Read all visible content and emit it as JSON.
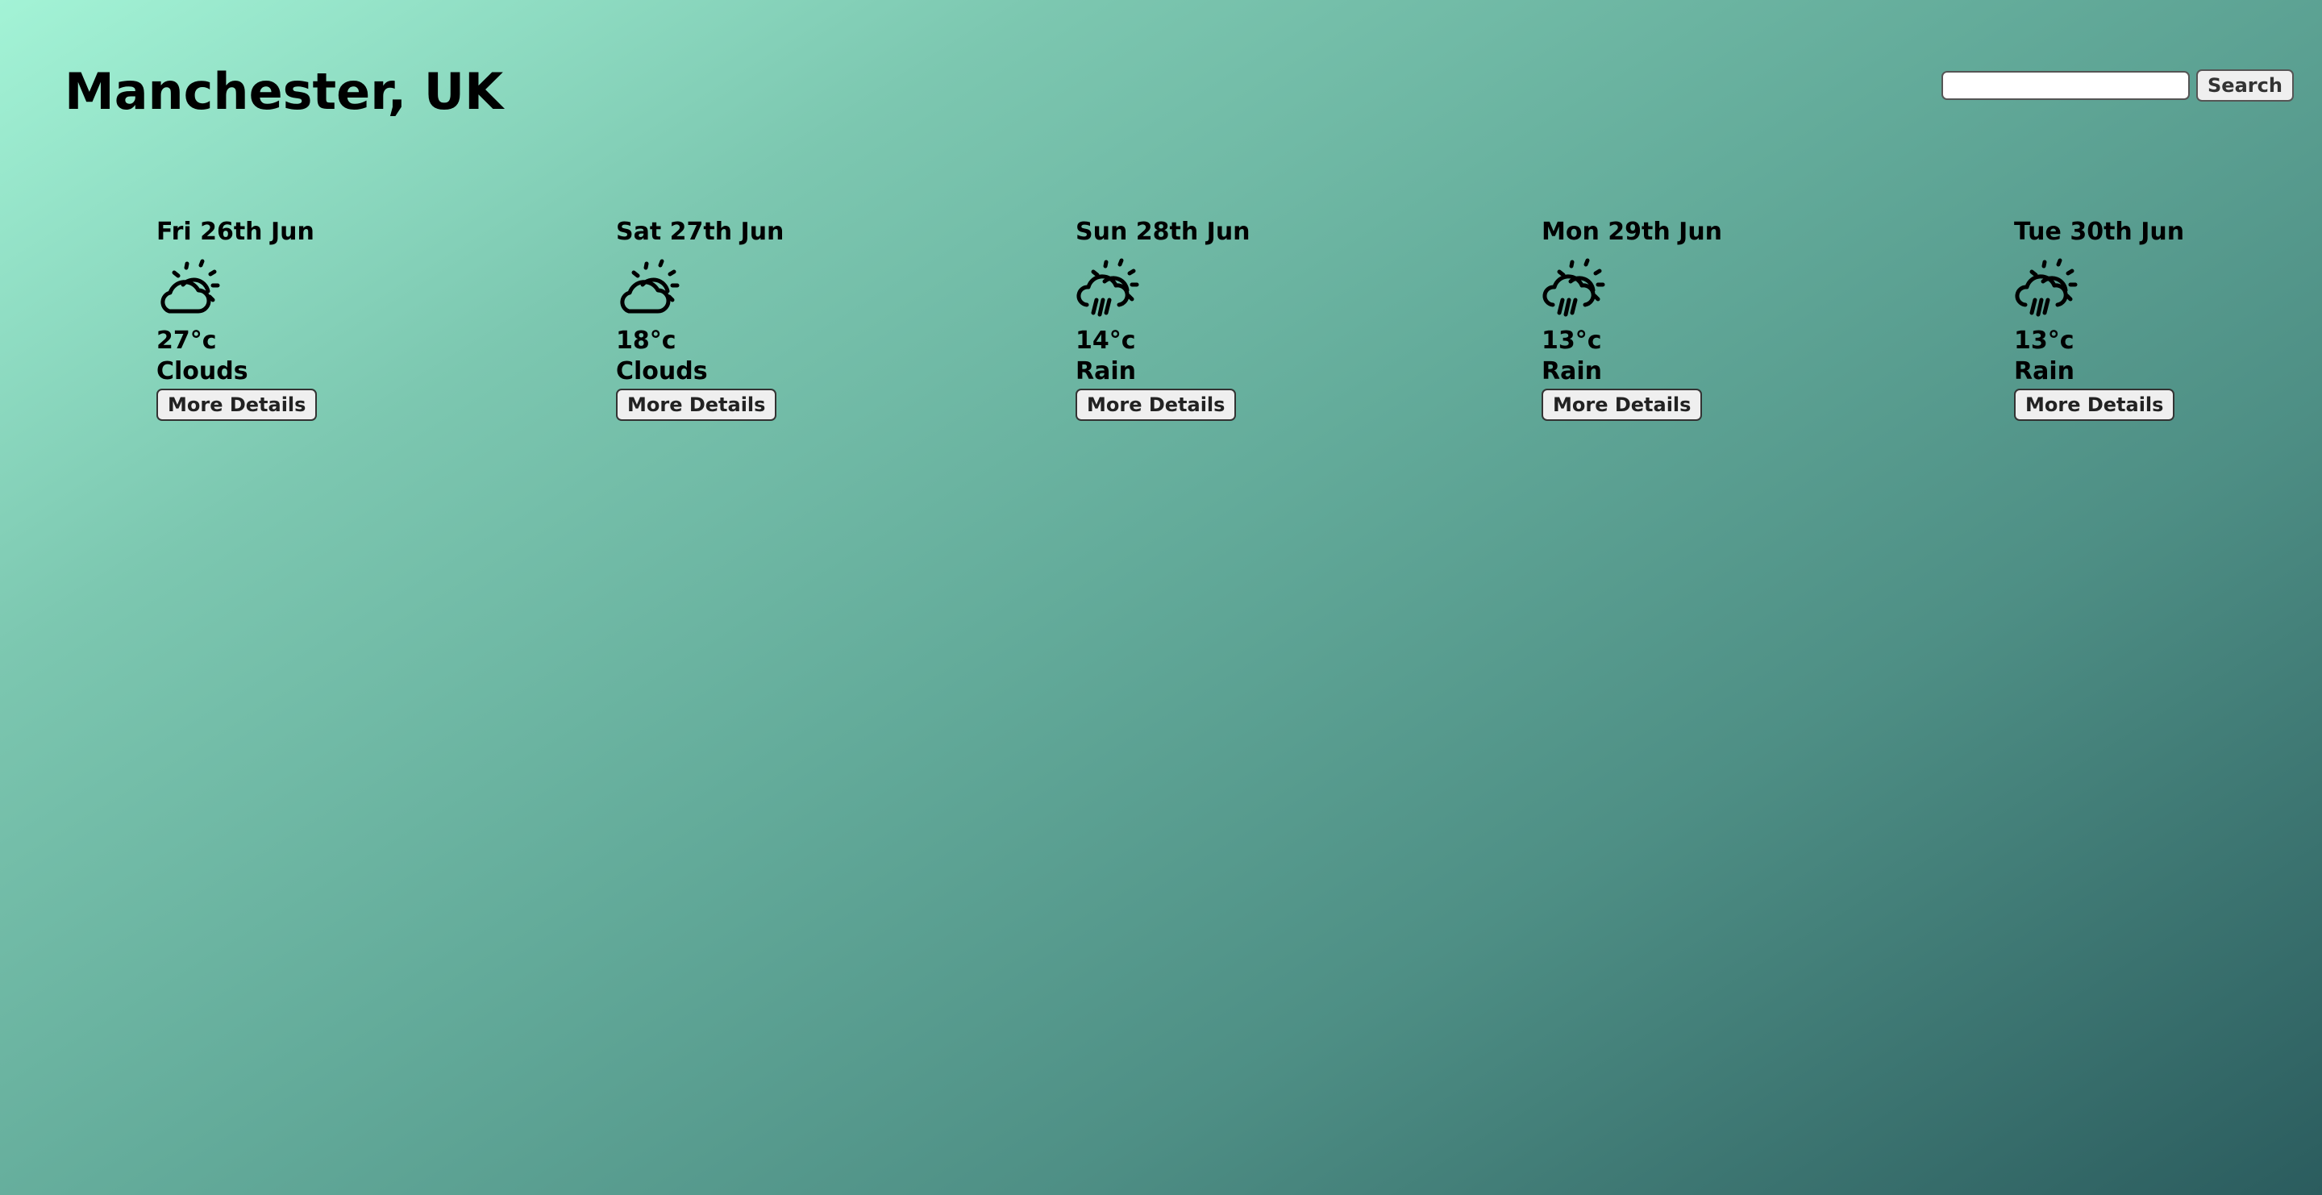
{
  "header": {
    "city": "Manchester, UK"
  },
  "search": {
    "value": "",
    "placeholder": "",
    "button_label": "Search"
  },
  "forecast": [
    {
      "date": "Fri 26th Jun",
      "temp": "27°c",
      "condition": "Clouds",
      "icon": "partly-cloudy-icon",
      "button_label": "More Details"
    },
    {
      "date": "Sat 27th Jun",
      "temp": "18°c",
      "condition": "Clouds",
      "icon": "partly-cloudy-icon",
      "button_label": "More Details"
    },
    {
      "date": "Sun 28th Jun",
      "temp": "14°c",
      "condition": "Rain",
      "icon": "sun-rain-cloud-icon",
      "button_label": "More Details"
    },
    {
      "date": "Mon 29th Jun",
      "temp": "13°c",
      "condition": "Rain",
      "icon": "sun-rain-cloud-icon",
      "button_label": "More Details"
    },
    {
      "date": "Tue 30th Jun",
      "temp": "13°c",
      "condition": "Rain",
      "icon": "sun-rain-cloud-icon",
      "button_label": "More Details"
    }
  ],
  "colors": {
    "background_start": "#a3f3d6",
    "background_end": "#2b5c5e",
    "text": "#000000"
  }
}
